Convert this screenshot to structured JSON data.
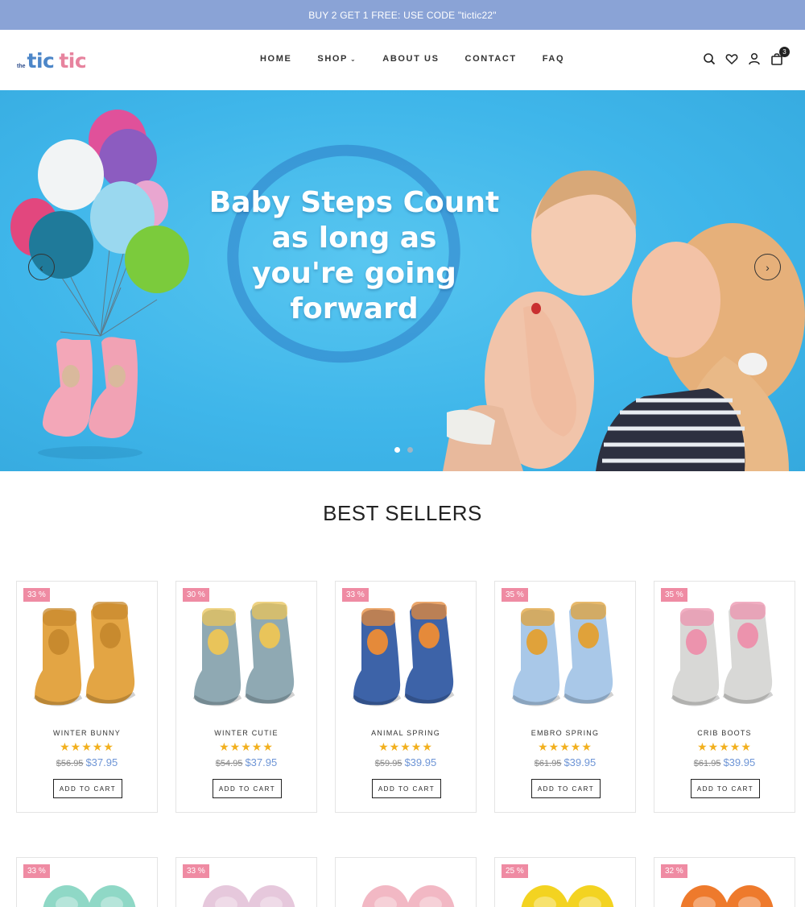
{
  "promo": {
    "text": "BUY 2 GET 1 FREE: USE CODE \"tictic22\""
  },
  "logo": {
    "small": "the",
    "word1": "tic",
    "word2": "tic"
  },
  "nav": [
    {
      "label": "HOME",
      "dropdown": false
    },
    {
      "label": "SHOP",
      "dropdown": true
    },
    {
      "label": "ABOUT US",
      "dropdown": false
    },
    {
      "label": "CONTACT",
      "dropdown": false
    },
    {
      "label": "FAQ",
      "dropdown": false
    }
  ],
  "header_icons": {
    "search": "search-icon",
    "wishlist": "heart-icon",
    "account": "user-icon",
    "cart": "bag-icon",
    "cart_count": "3"
  },
  "hero": {
    "headline": [
      "Baby Steps Count",
      "as long as",
      "you're going",
      "forward"
    ],
    "slides": 2,
    "active_slide": 1
  },
  "best_sellers": {
    "title": "BEST SELLERS",
    "add_to_cart_label": "ADD TO CART",
    "products": [
      {
        "name": "WINTER BUNNY",
        "discount": "33 %",
        "old_price": "$56.95",
        "price": "$37.95",
        "rating": 5,
        "color": "#e3a544",
        "accent": "#c88a2e"
      },
      {
        "name": "WINTER CUTIE",
        "discount": "30 %",
        "old_price": "$54.95",
        "price": "$37.95",
        "rating": 5,
        "color": "#8fa9b3",
        "accent": "#e9c45a"
      },
      {
        "name": "ANIMAL SPRING",
        "discount": "33 %",
        "old_price": "$59.95",
        "price": "$39.95",
        "rating": 5,
        "color": "#3d63a8",
        "accent": "#e58a3a"
      },
      {
        "name": "EMBRO SPRING",
        "discount": "35 %",
        "old_price": "$61.95",
        "price": "$39.95",
        "rating": 5,
        "color": "#a9c8e8",
        "accent": "#e0a23a"
      },
      {
        "name": "CRIB BOOTS",
        "discount": "35 %",
        "old_price": "$61.95",
        "price": "$39.95",
        "rating": 5,
        "color": "#d8d8d6",
        "accent": "#ec93ad"
      }
    ],
    "products_row2": [
      {
        "discount": "33 %",
        "color": "#8fd8c6"
      },
      {
        "discount": "33 %",
        "color": "#e6c8dc"
      },
      {
        "discount": "",
        "color": "#f2b8c4"
      },
      {
        "discount": "25 %",
        "color": "#f3d321"
      },
      {
        "discount": "32 %",
        "color": "#ee7a2c"
      }
    ]
  }
}
